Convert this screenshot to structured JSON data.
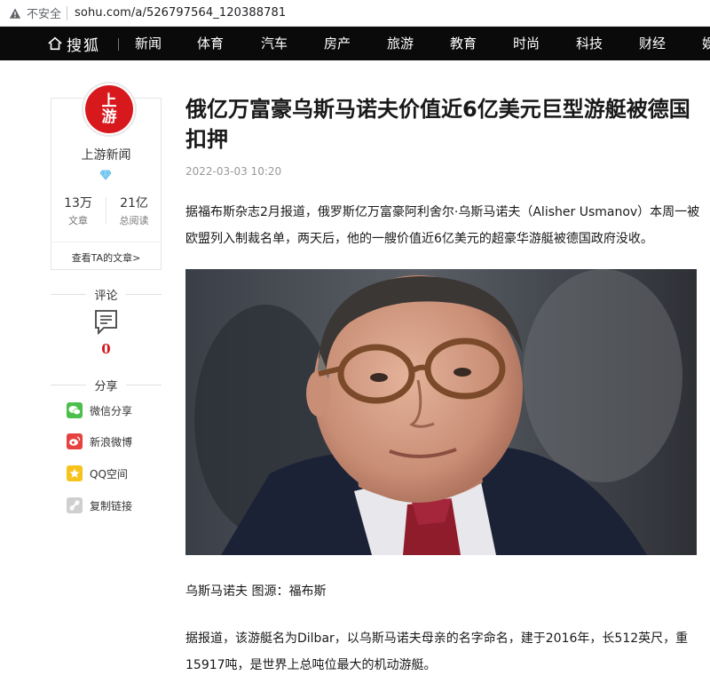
{
  "browser": {
    "security_label": "不安全",
    "url": "sohu.com/a/526797564_120388781"
  },
  "nav": {
    "logo": "搜狐",
    "items": [
      "新闻",
      "体育",
      "汽车",
      "房产",
      "旅游",
      "教育",
      "时尚",
      "科技",
      "财经",
      "娱"
    ]
  },
  "author": {
    "avatar_text_top": "上",
    "avatar_text_bottom": "游",
    "name": "上游新闻",
    "articles_value": "13万",
    "articles_label": "文章",
    "reads_value": "21亿",
    "reads_label": "总阅读",
    "more_link": "查看TA的文章>"
  },
  "comments": {
    "heading": "评论",
    "count": "0"
  },
  "share": {
    "heading": "分享",
    "items": [
      {
        "label": "微信分享",
        "icon": "wechat-icon",
        "color": "#4cbf4b"
      },
      {
        "label": "新浪微博",
        "icon": "weibo-icon",
        "color": "#e6423f"
      },
      {
        "label": "QQ空间",
        "icon": "qzone-icon",
        "color": "#f7c21b"
      },
      {
        "label": "复制链接",
        "icon": "link-icon",
        "color": "#cfcfcf"
      }
    ]
  },
  "article": {
    "title": "俄亿万富豪乌斯马诺夫价值近6亿美元巨型游艇被德国扣押",
    "date": "2022-03-03 10:20",
    "para1": "据福布斯杂志2月报道，俄罗斯亿万富豪阿利舍尔·乌斯马诺夫（Alisher Usmanov）本周一被欧盟列入制裁名单，两天后，他的一艘价值近6亿美元的超豪华游艇被德国政府没收。",
    "caption": "乌斯马诺夫 图源：福布斯",
    "para2": "据报道，该游艇名为Dilbar，以乌斯马诺夫母亲的名字命名，建于2016年，长512英尺，重15917吨，是世界上总吨位最大的机动游艇。"
  },
  "colors": {
    "brand_red": "#d7191e",
    "nav_bg": "#0a0a0a"
  }
}
